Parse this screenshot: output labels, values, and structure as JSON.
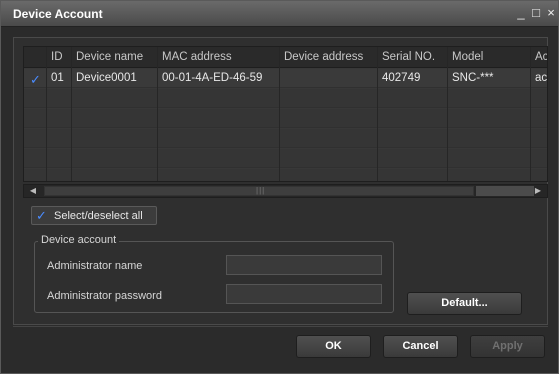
{
  "window": {
    "title": "Device Account",
    "minimize_icon": "_",
    "maximize_icon": "□",
    "close_icon": "×"
  },
  "table": {
    "headers": [
      "ID",
      "Device name",
      "MAC address",
      "Device address",
      "Serial NO.",
      "Model",
      "Ac"
    ],
    "rows": [
      {
        "checked": true,
        "check_icon": "✓",
        "id": "01",
        "device_name": "Device0001",
        "mac_address": "00-01-4A-ED-46-59",
        "device_address": "",
        "serial_no": "402749",
        "model": "SNC-***",
        "account": "ac"
      }
    ]
  },
  "scrollbar": {
    "left_arrow": "◀",
    "right_arrow": "▶",
    "grip": "|||"
  },
  "select_all": {
    "checked": true,
    "check_icon": "✓",
    "label": "Select/deselect all"
  },
  "device_account": {
    "legend": "Device account",
    "admin_name_label": "Administrator name",
    "admin_name_value": "",
    "admin_password_label": "Administrator password",
    "admin_password_value": ""
  },
  "buttons": {
    "default": "Default...",
    "ok": "OK",
    "cancel": "Cancel",
    "apply": "Apply"
  }
}
